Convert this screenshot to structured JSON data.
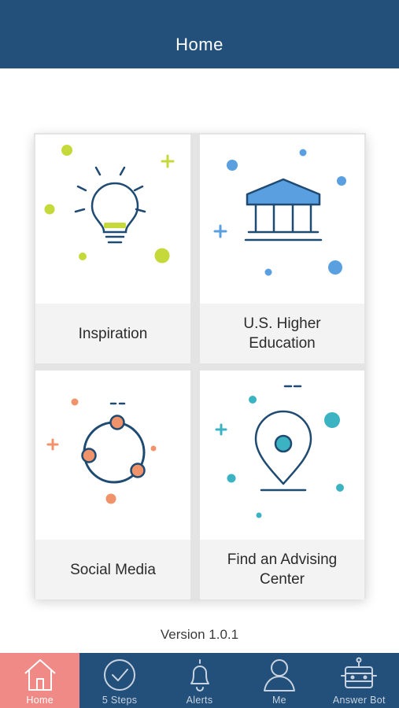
{
  "header": {
    "title": "Home"
  },
  "cards": [
    {
      "label": "Inspiration",
      "icon": "lightbulb-icon"
    },
    {
      "label": "U.S. Higher Education",
      "icon": "university-building-icon"
    },
    {
      "label": "Social Media",
      "icon": "network-circle-icon"
    },
    {
      "label": "Find an Advising Center",
      "icon": "location-pin-icon"
    }
  ],
  "footer": {
    "version": "Version 1.0.1"
  },
  "tabs": [
    {
      "label": "Home",
      "icon": "home-icon",
      "active": true
    },
    {
      "label": "5 Steps",
      "icon": "checkmark-circle-icon",
      "active": false
    },
    {
      "label": "Alerts",
      "icon": "bell-icon",
      "active": false
    },
    {
      "label": "Me",
      "icon": "user-icon",
      "active": false
    },
    {
      "label": "Answer Bot",
      "icon": "robot-icon",
      "active": false
    }
  ],
  "colors": {
    "header": "#23507b",
    "active_tab": "#f08a87",
    "inspiration_accent": "#c5d93a",
    "education_accent": "#5a9fe0",
    "social_accent": "#f0936a",
    "advising_accent": "#3bb3c3",
    "icon_stroke": "#1f4a72"
  }
}
